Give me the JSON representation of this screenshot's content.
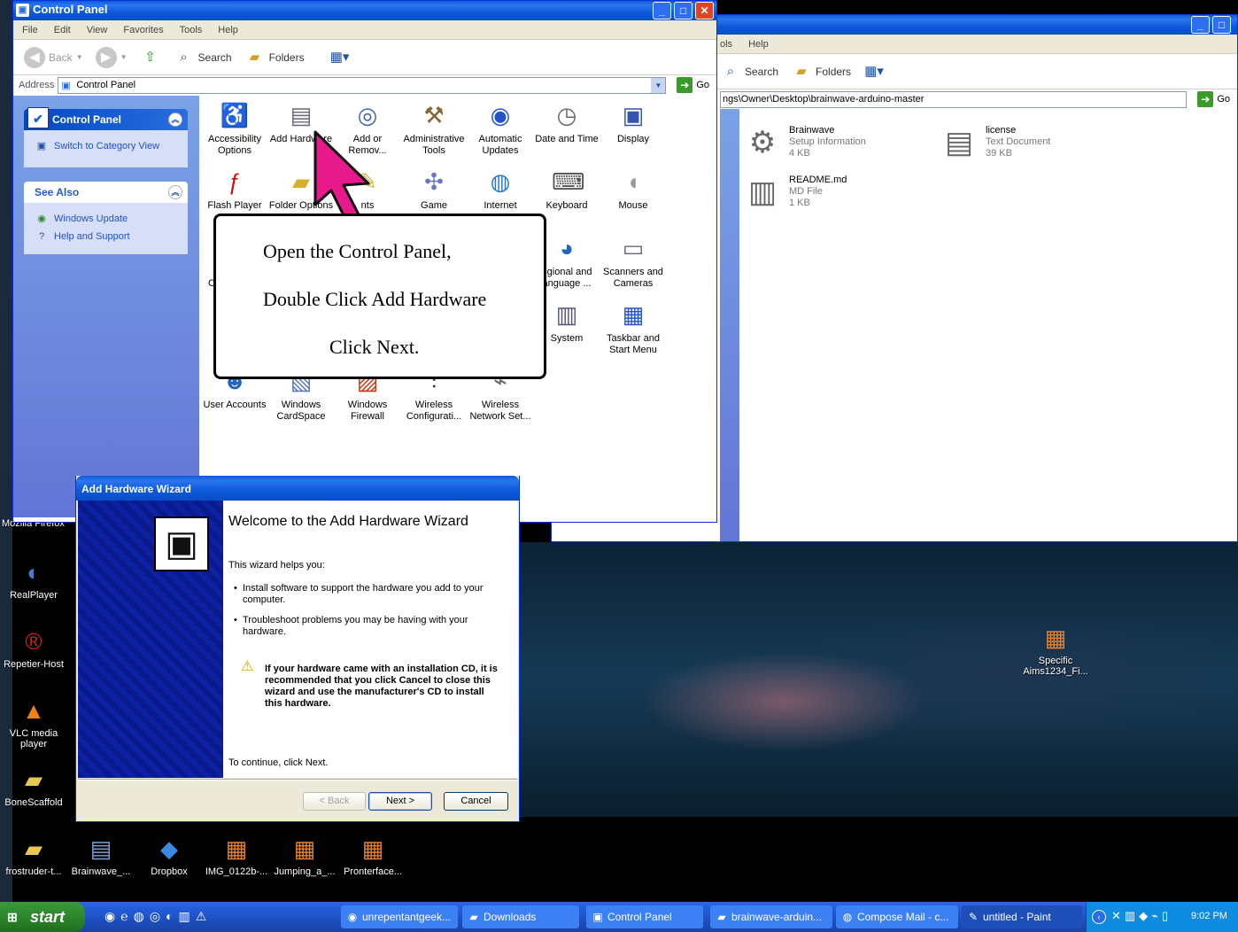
{
  "desktop": {
    "icons": [
      {
        "label": "RealPlayer",
        "icon": "realplayer-icon",
        "glyph": "◐"
      },
      {
        "label": "Repetier-Host",
        "icon": "repetier-icon",
        "glyph": "®"
      },
      {
        "label": "VLC media player",
        "icon": "vlc-icon",
        "glyph": "▲"
      },
      {
        "label": "BoneScaffold",
        "icon": "folder-icon",
        "glyph": "▰"
      },
      {
        "label": "frostruder-t...",
        "icon": "folder-icon",
        "glyph": "▰"
      },
      {
        "label": "Brainwave_...",
        "icon": "document-icon",
        "glyph": "▤"
      },
      {
        "label": "Dropbox",
        "icon": "dropbox-icon",
        "glyph": "◆"
      },
      {
        "label": "IMG_0122b-...",
        "icon": "image-file-icon",
        "glyph": "▦"
      },
      {
        "label": "Jumping_a_...",
        "icon": "image-file-icon",
        "glyph": "▦"
      },
      {
        "label": "Pronterface...",
        "icon": "image-file-icon",
        "glyph": "▦"
      },
      {
        "label": "Specific Aims1234_Fi...",
        "icon": "image-file-icon",
        "glyph": "▦"
      }
    ],
    "partial_labels": [
      "Mozilla Firefox"
    ]
  },
  "explorer": {
    "menu": [
      "ols",
      "Help"
    ],
    "search_label": "Search",
    "folders_label": "Folders",
    "address": "ngs\\Owner\\Desktop\\brainwave-arduino-master",
    "go_label": "Go",
    "files": [
      {
        "name": "Brainwave",
        "type": "Setup Information",
        "size": "4 KB",
        "icon": "setup-info-icon"
      },
      {
        "name": "license",
        "type": "Text Document",
        "size": "39 KB",
        "icon": "text-document-icon"
      },
      {
        "name": "README.md",
        "type": "MD File",
        "size": "1 KB",
        "icon": "md-file-icon"
      }
    ]
  },
  "control_panel": {
    "title": "Control Panel",
    "menu": [
      "File",
      "Edit",
      "View",
      "Favorites",
      "Tools",
      "Help"
    ],
    "toolbar": {
      "back": "Back",
      "search": "Search",
      "folders": "Folders"
    },
    "address_label": "Address",
    "address": "Control Panel",
    "go_label": "Go",
    "taskpane": {
      "panel_title": "Control Panel",
      "switch_view": "Switch to Category View",
      "see_also_title": "See Also",
      "see_also": [
        "Windows Update",
        "Help and Support"
      ]
    },
    "items": [
      {
        "label": "Accessibility Options",
        "glyph": "♿",
        "color": "#2a9a2a"
      },
      {
        "label": "Add Hardware",
        "glyph": "▤",
        "color": "#667"
      },
      {
        "label": "Add or Remov...",
        "glyph": "◎",
        "color": "#4466aa"
      },
      {
        "label": "Administrative Tools",
        "glyph": "⚒",
        "color": "#886633"
      },
      {
        "label": "Automatic Updates",
        "glyph": "◉",
        "color": "#2255cc"
      },
      {
        "label": "Date and Time",
        "glyph": "◷",
        "color": "#666"
      },
      {
        "label": "Display",
        "glyph": "▣",
        "color": "#3355aa"
      },
      {
        "label": "Flash Player",
        "glyph": "ƒ",
        "color": "#cc1111"
      },
      {
        "label": "Folder Options",
        "glyph": "▰",
        "color": "#d4b030"
      },
      {
        "label": "nts",
        "glyph": "✎",
        "color": "#d4b030"
      },
      {
        "label": "Game",
        "glyph": "✣",
        "color": "#6677bb"
      },
      {
        "label": "Internet",
        "glyph": "◍",
        "color": "#2277cc"
      },
      {
        "label": "Keyboard",
        "glyph": "⌨",
        "color": "#555"
      },
      {
        "label": "Mouse",
        "glyph": "◖",
        "color": "#999"
      },
      {
        "label": "egional and anguage ...",
        "glyph": "◕",
        "color": "#2266bb"
      },
      {
        "label": "Scanners and Cameras",
        "glyph": "▭",
        "color": "#667"
      },
      {
        "label": "System",
        "glyph": "▥",
        "color": "#557"
      },
      {
        "label": "Taskbar and Start Menu",
        "glyph": "▦",
        "color": "#2255cc"
      },
      {
        "label": "User Accounts",
        "glyph": "☻",
        "color": "#2266bb"
      },
      {
        "label": "Windows CardSpace",
        "glyph": "▧",
        "color": "#5577bb"
      },
      {
        "label": "Windows Firewall",
        "glyph": "▨",
        "color": "#cc3311"
      },
      {
        "label": "Wireless Configurati...",
        "glyph": "⫶",
        "color": "#333"
      },
      {
        "label": "Wireless Network Set...",
        "glyph": "⌁",
        "color": "#666"
      }
    ],
    "partial_labels": [
      "C"
    ]
  },
  "callout": {
    "line1": "Open the Control Panel,",
    "line2": "Double Click Add Hardware",
    "line3": "Click  Next."
  },
  "wizard": {
    "title": "Add Hardware Wizard",
    "heading": "Welcome to the Add Hardware Wizard",
    "intro": "This wizard helps you:",
    "bullets": [
      "Install software to support the hardware you add to your computer.",
      "Troubleshoot problems you may be having with your hardware."
    ],
    "warning": "If your hardware came with an installation CD, it is recommended that you click Cancel to close this wizard and use the manufacturer's CD to install this hardware.",
    "continue": "To continue, click Next.",
    "back_label": "< Back",
    "next_label": "Next >",
    "cancel_label": "Cancel"
  },
  "taskbar": {
    "start_label": "start",
    "tasks": [
      {
        "label": "unrepentantgeek...",
        "icon": "chrome-icon",
        "glyph": "◉"
      },
      {
        "label": "Downloads",
        "icon": "folder-icon",
        "glyph": "▰"
      },
      {
        "label": "Control Panel",
        "icon": "control-panel-icon",
        "glyph": "▣"
      },
      {
        "label": "brainwave-arduin...",
        "icon": "folder-icon",
        "glyph": "▰"
      },
      {
        "label": "Compose Mail - c...",
        "icon": "firefox-icon",
        "glyph": "◍"
      },
      {
        "label": "untitled - Paint",
        "icon": "paint-icon",
        "glyph": "✎"
      }
    ],
    "clock": "9:02 PM"
  },
  "colors": {
    "accent": "#0a5ad8",
    "start": "#2f8a2f",
    "taskpane": "#6f8fe0"
  }
}
